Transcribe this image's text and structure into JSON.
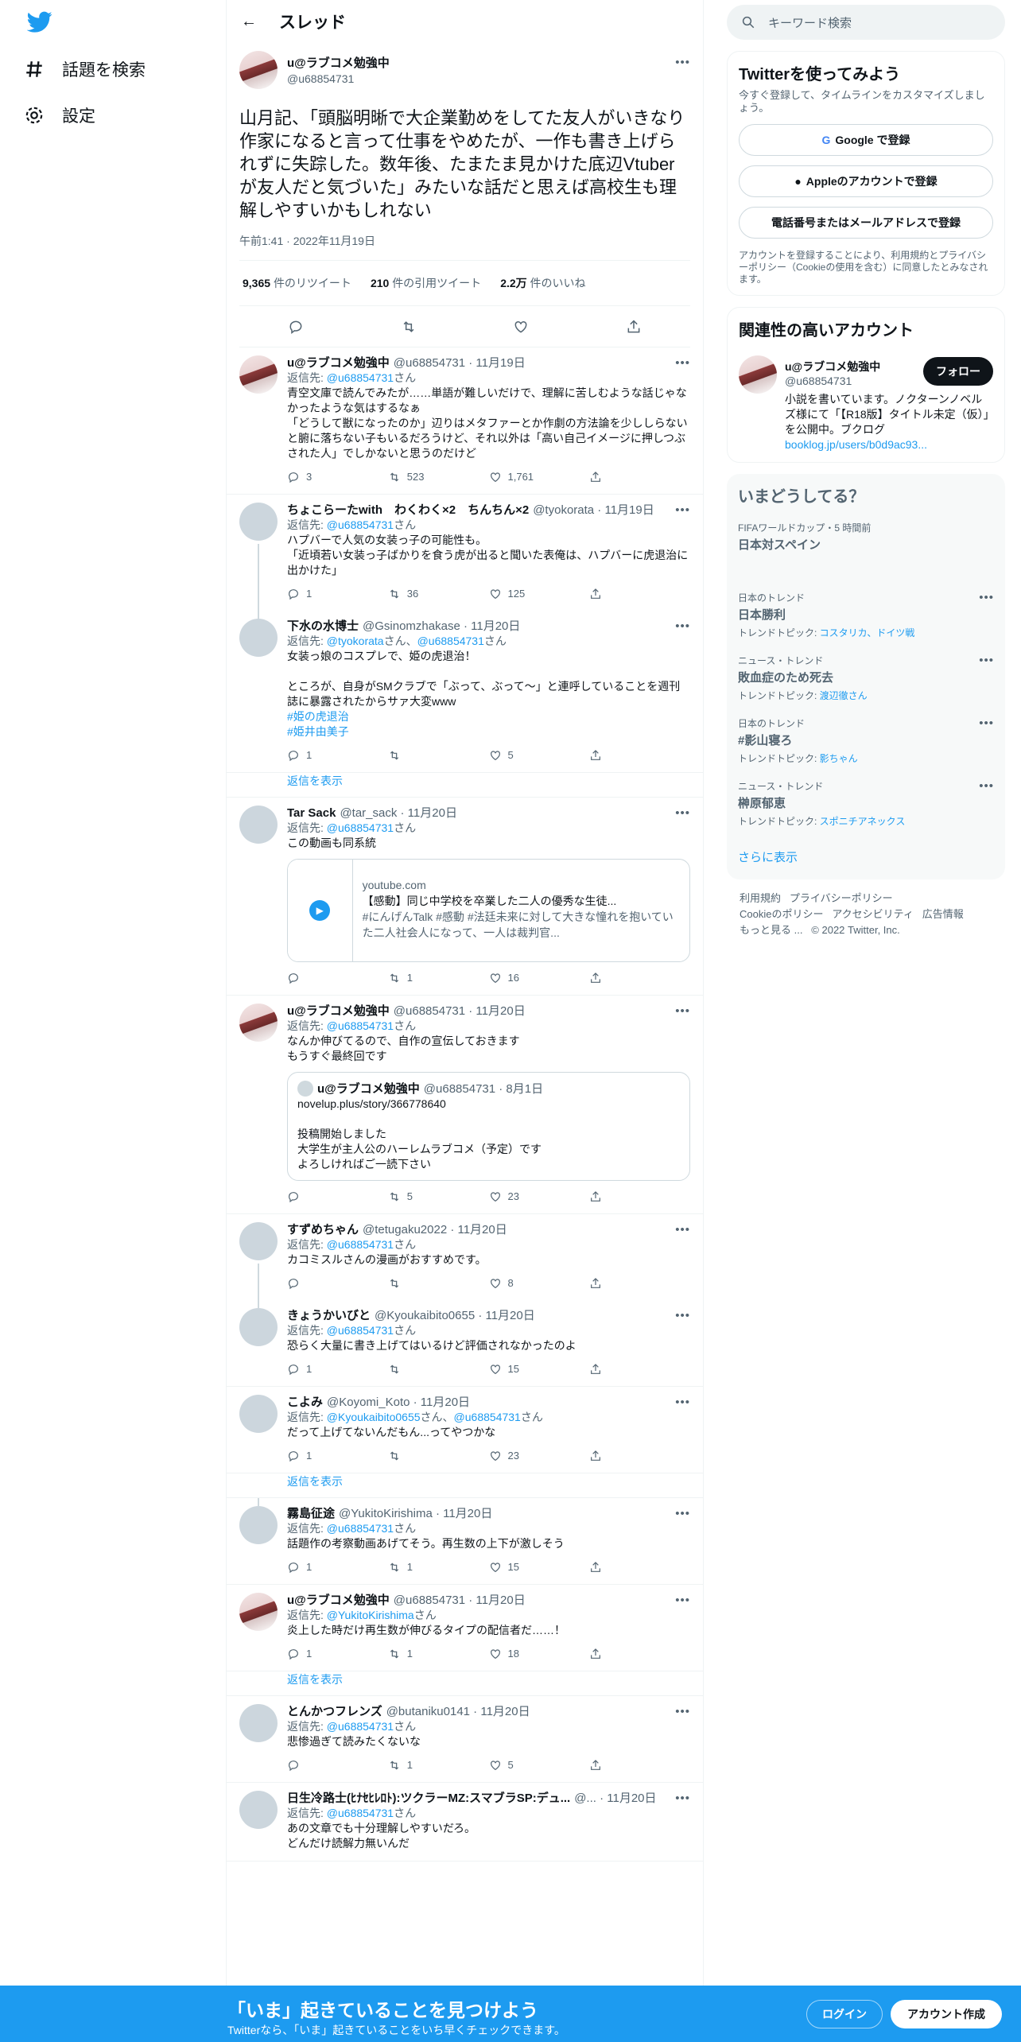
{
  "nav": {
    "explore": "話題を検索",
    "settings": "設定"
  },
  "header": {
    "title": "スレッド"
  },
  "focal": {
    "name": "u@ラブコメ勉強中",
    "handle": "@u68854731",
    "text": "山月記、「頭脳明晰で大企業勤めをしてた友人がいきなり作家になると言って仕事をやめたが、一作も書き上げられずに失踪した。数年後、たまたま見かけた底辺Vtuberが友人だと気づいた」みたいな話だと思えば高校生も理解しやすいかもしれない",
    "time": "午前1:41 · 2022年11月19日",
    "retweets": "9,365",
    "retweets_label": "件のリツイート",
    "quotes": "210",
    "quotes_label": "件の引用ツイート",
    "likes": "2.2万",
    "likes_label": "件のいいね"
  },
  "replies": [
    {
      "name": "u@ラブコメ勉強中",
      "handle": "@u68854731 · 11月19日",
      "to": "@u68854731",
      "text": "青空文庫で読んでみたが……単語が難しいだけで、理解に苦しむような話じゃなかったような気はするなぁ\n「どうして獣になったのか」辺りはメタファーとか作劇の方法論を少ししらないと腑に落ちない子もいるだろうけど、それ以外は「高い自己イメージに押しつぶされた人」でしかないと思うのだけど",
      "c": "3",
      "r": "523",
      "l": "1,761"
    },
    {
      "name": "ちょこらーたwith　わくわく×2　ちんちん×2",
      "handle": "@tyokorata · 11月19日",
      "to": "@u68854731",
      "text": "ハプバーで人気の女装っ子の可能性も。\n「近頃若い女装っ子ばかりを食う虎が出ると聞いた表俺は、ハプバーに虎退治に出かけた」",
      "c": "1",
      "r": "36",
      "l": "125"
    },
    {
      "name": "下水の水博士",
      "handle": "@Gsinomzhakase · 11月20日",
      "to": "@tyokorata",
      "to2": "@u68854731",
      "text": "女装っ娘のコスプレで、姫の虎退治！\n\nところが、自身がSMクラブで「ぶって、ぶって〜」と連呼していることを週刊誌に暴露されたからサァ大変www",
      "tags": [
        "#姫の虎退治",
        "#姫井由美子"
      ],
      "c": "1",
      "r": "",
      "l": "5"
    },
    {
      "show_more": "返信を表示"
    },
    {
      "name": "Tar Sack",
      "handle": "@tar_sack · 11月20日",
      "to": "@u68854731",
      "text": "この動画も同系統",
      "card": {
        "domain": "youtube.com",
        "title": "【感動】同じ中学校を卒業した二人の優秀な生徒...",
        "desc": "#にんげんTalk #感動 #法廷未来に対して大きな憧れを抱いていた二人社会人になって、一人は裁判官..."
      },
      "c": "",
      "r": "1",
      "l": "16"
    },
    {
      "name": "u@ラブコメ勉強中",
      "handle": "@u68854731 · 11月20日",
      "to": "@u68854731",
      "text": "なんか伸びてるので、自作の宣伝しておきます\nもうすぐ最終回です",
      "quote": {
        "name": "u@ラブコメ勉強中",
        "handle": "@u68854731 · 8月1日",
        "text": "novelup.plus/story/366778640\n\n投稿開始しました\n大学生が主人公のハーレムラブコメ（予定）です\nよろしければご一読下さい"
      },
      "c": "",
      "r": "5",
      "l": "23"
    },
    {
      "name": "すずめちゃん",
      "handle": "@tetugaku2022 · 11月20日",
      "to": "@u68854731",
      "text": "カコミスルさんの漫画がおすすめです。",
      "c": "",
      "r": "",
      "l": "8"
    },
    {
      "name": "きょうかいびと",
      "handle": "@Kyoukaibito0655 · 11月20日",
      "to": "@u68854731",
      "text": "恐らく大量に書き上げてはいるけど評価されなかったのよ",
      "c": "1",
      "r": "",
      "l": "15"
    },
    {
      "name": "こよみ",
      "handle": "@Koyomi_Koto · 11月20日",
      "to": "@Kyoukaibito0655",
      "to2": "@u68854731",
      "text": "だって上げてないんだもん...ってやつかな",
      "c": "1",
      "r": "",
      "l": "23"
    },
    {
      "show_more": "返信を表示"
    },
    {
      "name": "霧島征途",
      "handle": "@YukitoKirishima · 11月20日",
      "to": "@u68854731",
      "text": "話題作の考察動画あげてそう。再生数の上下が激しそう",
      "c": "1",
      "r": "1",
      "l": "15"
    },
    {
      "name": "u@ラブコメ勉強中",
      "handle": "@u68854731 · 11月20日",
      "to": "@YukitoKirishima",
      "text": "炎上した時だけ再生数が伸びるタイプの配信者だ……！",
      "c": "1",
      "r": "1",
      "l": "18"
    },
    {
      "show_more": "返信を表示"
    },
    {
      "name": "とんかつフレンズ",
      "handle": "@butaniku0141 · 11月20日",
      "to": "@u68854731",
      "text": "悲惨過ぎて読みたくないな",
      "c": "",
      "r": "1",
      "l": "5"
    },
    {
      "name": "日生冷路士(ﾋﾅｾﾋﾚﾛﾄ):ツクラーMZ:スマブラSP:デュ...",
      "handle": "@... · 11月20日",
      "to": "@u68854731",
      "text": "あの文章でも十分理解しやすいだろ。\nどんだけ読解力無いんだ"
    }
  ],
  "reply_prefix": "返信先: ",
  "reply_suffix": "さん",
  "and": "、",
  "right": {
    "search_placeholder": "キーワード検索",
    "signup": {
      "title": "Twitterを使ってみよう",
      "sub": "今すぐ登録して、タイムラインをカスタマイズしましょう。",
      "google": "Google で登録",
      "apple": "Appleのアカウントで登録",
      "phone": "電話番号またはメールアドレスで登録",
      "terms": "アカウントを登録することにより、利用規約とプライバシーポリシー（Cookieの使用を含む）に同意したとみなされます。"
    },
    "related": {
      "title": "関連性の高いアカウント",
      "name": "u@ラブコメ勉強中",
      "handle": "@u68854731",
      "follow": "フォロー",
      "bio": "小説を書いています。ノクターンノベルズ様にて「【R18版】タイトル未定（仮）」を公開中。ブクログ",
      "link": "booklog.jp/users/b0d9ac93..."
    },
    "trends": {
      "title": "いまどうしてる？",
      "items": [
        {
          "cat": "FIFAワールドカップ・5 時間前",
          "tt": "日本対スペイン",
          "tp": ""
        },
        {
          "cat": "日本のトレンド",
          "tt": "日本勝利",
          "tp": "トレンドトピック: ",
          "tl": "コスタリカ、ドイツ戦"
        },
        {
          "cat": "ニュース・トレンド",
          "tt": "敗血症のため死去",
          "tp": "トレンドトピック: ",
          "tl": "渡辺徹さん"
        },
        {
          "cat": "日本のトレンド",
          "tt": "#影山寝ろ",
          "tp": "トレンドトピック: ",
          "tl": "影ちゃん"
        },
        {
          "cat": "ニュース・トレンド",
          "tt": "榊原郁恵",
          "tp": "トレンドトピック: ",
          "tl": "スポニチアネックス"
        }
      ],
      "more": "さらに表示"
    },
    "footer": [
      "利用規約",
      "プライバシーポリシー",
      "Cookieのポリシー",
      "アクセシビリティ",
      "広告情報",
      "もっと見る ...",
      "© 2022 Twitter, Inc."
    ]
  },
  "banner": {
    "title": "「いま」起きていることを見つけよう",
    "sub": "Twitterなら、「いま」起きていることをいち早くチェックできます。",
    "login": "ログイン",
    "signup": "アカウント作成"
  }
}
